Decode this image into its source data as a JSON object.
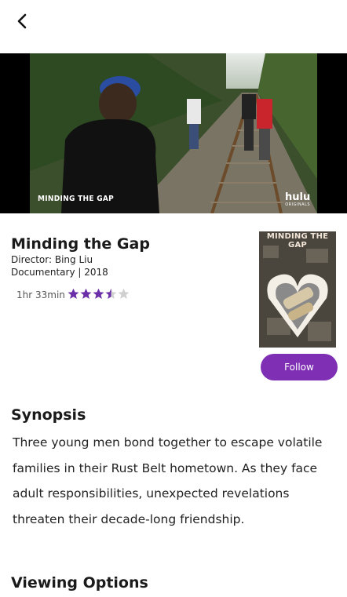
{
  "hero": {
    "overlay_title": "MINDING THE GAP",
    "logo_brand": "hulu",
    "logo_sub": "ORIGINALS"
  },
  "movie": {
    "title": "Minding the Gap",
    "director": "Director: Bing Liu",
    "genre_year": "Documentary | 2018",
    "runtime": "1hr 33min",
    "rating": 3.5,
    "rating_max": 5
  },
  "poster": {
    "title": "MINDING THE GAP"
  },
  "actions": {
    "follow_label": "Follow"
  },
  "synopsis": {
    "heading": "Synopsis",
    "text": "Three young men bond together to escape volatile families in their Rust Belt hometown. As they face adult responsibilities, unexpected revelations threaten their decade-long friendship."
  },
  "viewing": {
    "heading": "Viewing Options"
  },
  "colors": {
    "accent": "#7e2fb3",
    "star_filled": "#6a2fa8",
    "star_empty": "#d0d0d0"
  }
}
